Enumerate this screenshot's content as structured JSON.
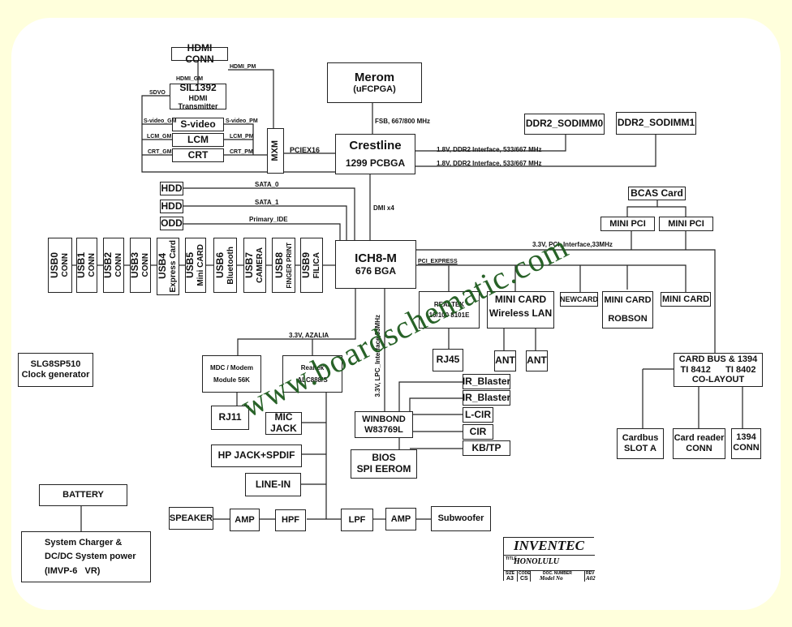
{
  "diagram": {
    "blocks": {
      "hdmi_conn": "HDMI CONN",
      "sil1392": [
        "SIL1392",
        "HDMI Transmitter"
      ],
      "svideo": "S-video",
      "lcm": "LCM",
      "crt": "CRT",
      "mxm": "MXM",
      "merom": [
        "Merom",
        "(uFCPGA)"
      ],
      "crestline": [
        "Crestline",
        "1299 PCBGA"
      ],
      "ddr2_sodimm0": "DDR2_SODIMM0",
      "ddr2_sodimm1": "DDR2_SODIMM1",
      "hdd0": "HDD",
      "hdd1": "HDD",
      "odd": "ODD",
      "ich8m": [
        "ICH8-M",
        "676 BGA"
      ],
      "usb": [
        {
          "main": "USB0",
          "sub": "CONN"
        },
        {
          "main": "USB1",
          "sub": "CONN"
        },
        {
          "main": "USB2",
          "sub": "CONN"
        },
        {
          "main": "USB3",
          "sub": "CONN"
        },
        {
          "main": "USB4",
          "sub": "Express Card"
        },
        {
          "main": "USB5",
          "sub": "Mini CARD"
        },
        {
          "main": "USB6",
          "sub": "Bluetooth"
        },
        {
          "main": "USB7",
          "sub": "CAMERA"
        },
        {
          "main": "USB8",
          "sub": "FINGER PRINT"
        },
        {
          "main": "USB9",
          "sub": "FILICA"
        }
      ],
      "bcas_card": "BCAS Card",
      "mini_pci_1": "MINI PCI",
      "mini_pci_2": "MINI PCI",
      "realtek_lan": [
        "REALTEK",
        "10/100 8101E"
      ],
      "mini_card_wlan": [
        "MINI CARD",
        "Wireless LAN"
      ],
      "newcard": "NEWCARD",
      "mini_card_robson": [
        "MINI CARD",
        "ROBSON"
      ],
      "mini_card": "MINI CARD",
      "rj45": "RJ45",
      "ant1": "ANT",
      "ant2": "ANT",
      "cardbus_1394": [
        "CARD BUS & 1394",
        "TI 8412      TI 8402",
        "CO-LAYOUT"
      ],
      "cardbus_slot": [
        "Cardbus",
        "SLOT A"
      ],
      "card_reader": [
        "Card reader",
        "CONN"
      ],
      "conn_1394": [
        "1394",
        "CONN"
      ],
      "clock_gen": [
        "SLG8SP510",
        "Clock generator"
      ],
      "modem": [
        "MDC / Modem",
        "Module 56K"
      ],
      "realtek_audio": [
        "Realtek",
        "ALC888/S"
      ],
      "rj11": "RJ11",
      "mic_jack": [
        "MIC",
        "JACK"
      ],
      "hp_jack": "HP JACK+SPDIF",
      "line_in": "LINE-IN",
      "winbond": [
        "WINBOND",
        "W83769L"
      ],
      "bios": [
        "BIOS",
        "SPI EEROM"
      ],
      "ir_blaster_1": "IR_Blaster",
      "ir_blaster_2": "IR_Blaster",
      "l_cir": "L-CIR",
      "cir": "CIR",
      "kb_tp": "KB/TP",
      "battery": "BATTERY",
      "charger": [
        "System Charger &",
        "DC/DC System power",
        "(IMVP-6   VR)"
      ],
      "speaker": "SPEAKER",
      "amp1": "AMP",
      "hpf": "HPF",
      "lpf": "LPF",
      "amp2": "AMP",
      "subwoofer": "Subwoofer"
    },
    "signals": {
      "hdmi_pm": "HDMI_PM",
      "hdmi_gm": "HDMI_GM",
      "sdvo": "SDVO",
      "svideo_gm": "S-video_GM",
      "svideo_pm": "S-video_PM",
      "lcm_gm": "LCM_GM",
      "lcm_pm": "LCM_PM",
      "crt_gm": "CRT_GM",
      "crt_pm": "CRT_PM",
      "pciex16": "PCIEX16",
      "fsb": "FSB, 667/800 MHz",
      "ddr_if_0": "1.8V, DDR2 Interface, 533/667 MHz",
      "ddr_if_1": "1.8V, DDR2 Interface, 533/667 MHz",
      "dmi": "DMI x4",
      "sata0": "SATA_0",
      "sata1": "SATA_1",
      "primary_ide": "Primary_IDE",
      "pci_interface": "3.3V, PCI_Interface,33MHz",
      "pci_express": "PCI_EXPRESS",
      "azalia": "3.3V, AZALIA",
      "lpc": "3.3V, LPC_Interface,33MHz"
    },
    "title_block": {
      "company": "INVENTEC",
      "title_label": "TITLE",
      "title": "HONOLULU",
      "size_label": "SIZE",
      "size": "A3",
      "code_label": "CODE",
      "code": "CS",
      "doc_label": "DOC. NUMBER",
      "doc": "Model No",
      "rev_label": "REV",
      "rev": "A02"
    },
    "watermark": "www.boardschematic.com"
  }
}
